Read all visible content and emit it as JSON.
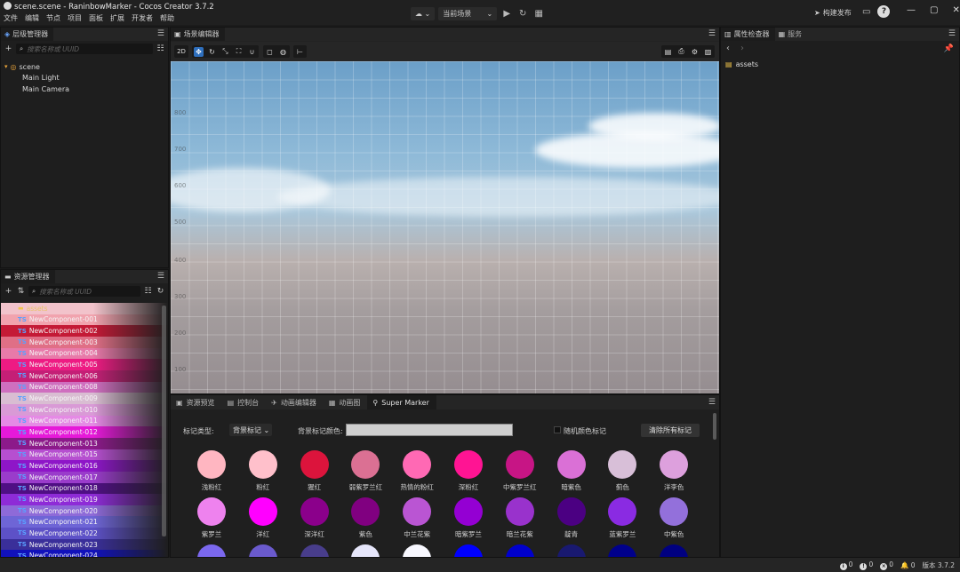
{
  "window": {
    "title": "scene.scene - RaninbowMarker - Cocos Creator 3.7.2",
    "menu": [
      "文件",
      "编辑",
      "节点",
      "项目",
      "面板",
      "扩展",
      "开发者",
      "帮助"
    ],
    "scene_selector": "当前场景",
    "build_publish": "构建发布"
  },
  "hierarchy": {
    "tab": "层级管理器",
    "search_placeholder": "搜索名称或 UUID",
    "root": "scene",
    "children": [
      "Main Light",
      "Main Camera"
    ]
  },
  "assets": {
    "tab": "资源管理器",
    "search_placeholder": "搜索名称或 UUID",
    "items": [
      {
        "label": "assets",
        "type": "folder",
        "color": "#f2c3cb"
      },
      {
        "label": "NewComponent-001",
        "type": "ts",
        "color": "#f1a3ae"
      },
      {
        "label": "NewComponent-002",
        "type": "ts",
        "color": "#c41a36"
      },
      {
        "label": "NewComponent-003",
        "type": "ts",
        "color": "#e06f86"
      },
      {
        "label": "NewComponent-004",
        "type": "ts",
        "color": "#e87aa9"
      },
      {
        "label": "NewComponent-005",
        "type": "ts",
        "color": "#ee1b83"
      },
      {
        "label": "NewComponent-006",
        "type": "ts",
        "color": "#c41f76"
      },
      {
        "label": "NewComponent-008",
        "type": "ts",
        "color": "#cf6fbf"
      },
      {
        "label": "NewComponent-009",
        "type": "ts",
        "color": "#d9bdd2"
      },
      {
        "label": "NewComponent-010",
        "type": "ts",
        "color": "#d99ad6"
      },
      {
        "label": "NewComponent-011",
        "type": "ts",
        "color": "#e58ae5"
      },
      {
        "label": "NewComponent-012",
        "type": "ts",
        "color": "#e619d9"
      },
      {
        "label": "NewComponent-013",
        "type": "ts",
        "color": "#8c1a8a"
      },
      {
        "label": "NewComponent-015",
        "type": "ts",
        "color": "#b64fd0"
      },
      {
        "label": "NewComponent-016",
        "type": "ts",
        "color": "#8e16c8"
      },
      {
        "label": "NewComponent-017",
        "type": "ts",
        "color": "#9a3ccb"
      },
      {
        "label": "NewComponent-018",
        "type": "ts",
        "color": "#4f0f84"
      },
      {
        "label": "NewComponent-019",
        "type": "ts",
        "color": "#8e2bd7"
      },
      {
        "label": "NewComponent-020",
        "type": "ts",
        "color": "#8e6ad8"
      },
      {
        "label": "NewComponent-021",
        "type": "ts",
        "color": "#6e65d6"
      },
      {
        "label": "NewComponent-022",
        "type": "ts",
        "color": "#5d51c7"
      },
      {
        "label": "NewComponent-023",
        "type": "ts",
        "color": "#3a2f9a"
      },
      {
        "label": "NewComponent-024",
        "type": "ts",
        "color": "#1111bb"
      }
    ]
  },
  "scene_editor": {
    "tab": "场景编辑器",
    "mode_2d": "2D",
    "axis_labels": [
      "800",
      "700",
      "600",
      "500",
      "400",
      "300",
      "200",
      "100"
    ]
  },
  "bottom_panel": {
    "tabs": [
      "资源预览",
      "控制台",
      "动画编辑器",
      "动画图",
      "Super Marker"
    ],
    "marker_type_label": "标记类型:",
    "marker_type_value": "背景标记",
    "bg_color_label": "背景标记颜色:",
    "bg_color_value": "#cfcfcf",
    "random_color_label": "随机颜色标记",
    "clear_button": "清除所有标记",
    "colors": [
      {
        "name": "浅粉红",
        "hex": "#ffb6c1"
      },
      {
        "name": "粉红",
        "hex": "#ffc0cb"
      },
      {
        "name": "猩红",
        "hex": "#dc143c"
      },
      {
        "name": "弱紫罗兰红",
        "hex": "#db7093"
      },
      {
        "name": "热情的粉红",
        "hex": "#ff69b4"
      },
      {
        "name": "深粉红",
        "hex": "#ff1493"
      },
      {
        "name": "中紫罗兰红",
        "hex": "#c71585"
      },
      {
        "name": "暗紫色",
        "hex": "#da70d6"
      },
      {
        "name": "蓟色",
        "hex": "#d8bfd8"
      },
      {
        "name": "洋李色",
        "hex": "#dda0dd"
      },
      {
        "name": "紫罗兰",
        "hex": "#ee82ee"
      },
      {
        "name": "洋红",
        "hex": "#ff00ff"
      },
      {
        "name": "深洋红",
        "hex": "#8b008b"
      },
      {
        "name": "紫色",
        "hex": "#800080"
      },
      {
        "name": "中兰花紫",
        "hex": "#ba55d3"
      },
      {
        "name": "暗紫罗兰",
        "hex": "#9400d3"
      },
      {
        "name": "暗兰花紫",
        "hex": "#9932cc"
      },
      {
        "name": "靛青",
        "hex": "#4b0082"
      },
      {
        "name": "蓝紫罗兰",
        "hex": "#8a2be2"
      },
      {
        "name": "中紫色",
        "hex": "#9370db"
      },
      {
        "name": "",
        "hex": "#7b68ee"
      },
      {
        "name": "",
        "hex": "#6a5acd"
      },
      {
        "name": "",
        "hex": "#483d8b"
      },
      {
        "name": "",
        "hex": "#e6e6fa"
      },
      {
        "name": "",
        "hex": "#f8f8ff"
      },
      {
        "name": "",
        "hex": "#0000ff"
      },
      {
        "name": "",
        "hex": "#0000cd"
      },
      {
        "name": "",
        "hex": "#191970"
      },
      {
        "name": "",
        "hex": "#00008b"
      },
      {
        "name": "",
        "hex": "#000080"
      }
    ]
  },
  "inspector": {
    "tabs": [
      "属性检查器",
      "服务"
    ],
    "selected": "assets"
  },
  "status": {
    "info_count": "0",
    "warn_count": "0",
    "error_count": "0",
    "notify_count": "0",
    "version": "版本 3.7.2"
  }
}
